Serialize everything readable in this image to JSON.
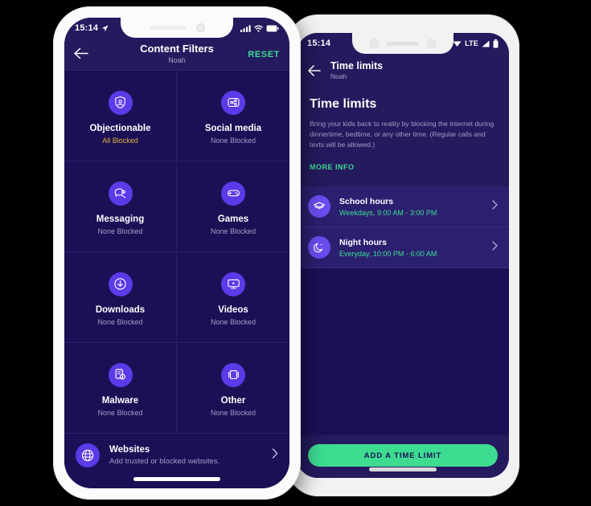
{
  "left_phone": {
    "status_bar": {
      "time": "15:14",
      "location_icon": "location-arrow-icon",
      "signal_icon": "cellular-bars-icon",
      "wifi_icon": "wifi-icon",
      "battery_icon": "battery-icon"
    },
    "header": {
      "back_icon": "back-arrow-icon",
      "title": "Content Filters",
      "subtitle": "Noah",
      "reset_label": "RESET"
    },
    "tiles": [
      {
        "label": "Objectionable",
        "status": "All Blocked",
        "status_state": "blocked",
        "icon": "shield-person-icon"
      },
      {
        "label": "Social media",
        "status": "None Blocked",
        "status_state": "none",
        "icon": "share-network-icon"
      },
      {
        "label": "Messaging",
        "status": "None Blocked",
        "status_state": "none",
        "icon": "chat-bubbles-icon"
      },
      {
        "label": "Games",
        "status": "None Blocked",
        "status_state": "none",
        "icon": "gamepad-icon"
      },
      {
        "label": "Downloads",
        "status": "None Blocked",
        "status_state": "none",
        "icon": "download-arrow-icon"
      },
      {
        "label": "Videos",
        "status": "None Blocked",
        "status_state": "none",
        "icon": "video-monitor-icon"
      },
      {
        "label": "Malware",
        "status": "None Blocked",
        "status_state": "none",
        "icon": "malware-bug-gear-icon"
      },
      {
        "label": "Other",
        "status": "None Blocked",
        "status_state": "none",
        "icon": "layers-square-icon"
      }
    ],
    "websites_row": {
      "icon": "globe-icon",
      "title": "Websites",
      "subtitle": "Add trusted or blocked websites.",
      "chevron": "chevron-right-icon"
    }
  },
  "right_phone": {
    "status_bar": {
      "time": "15:14",
      "wifi_icon": "wifi-icon",
      "network_label": "LTE",
      "signal_icon": "cellular-bars-icon",
      "battery_icon": "battery-icon"
    },
    "header": {
      "back_icon": "back-arrow-icon",
      "title": "Time limits",
      "subtitle": "Noah"
    },
    "hero": {
      "title": "Time limits",
      "description": "Bring your kids back to reality by blocking the internet during dinnertime, bedtime, or any other time. (Regular calls and texts will be allowed.)",
      "more_info_label": "MORE INFO"
    },
    "limits": [
      {
        "title": "School hours",
        "schedule": "Weekdays, 9:00 AM - 3:00 PM",
        "icon": "graduation-cap-icon",
        "chevron": "chevron-right-icon"
      },
      {
        "title": "Night hours",
        "schedule": "Everyday, 10:00 PM - 6:00 AM",
        "icon": "moon-icon",
        "chevron": "chevron-right-icon"
      }
    ],
    "footer": {
      "add_button_label": "ADD A TIME LIMIT"
    }
  },
  "colors": {
    "screen_bg": "#1b1056",
    "header_bg": "#241a5e",
    "accent_purple": "#5b3ae8",
    "accent_green": "#3ddc91",
    "warning_gold": "#e0b23c",
    "list_bg": "#2b2070",
    "muted_text": "#a49ec6"
  }
}
